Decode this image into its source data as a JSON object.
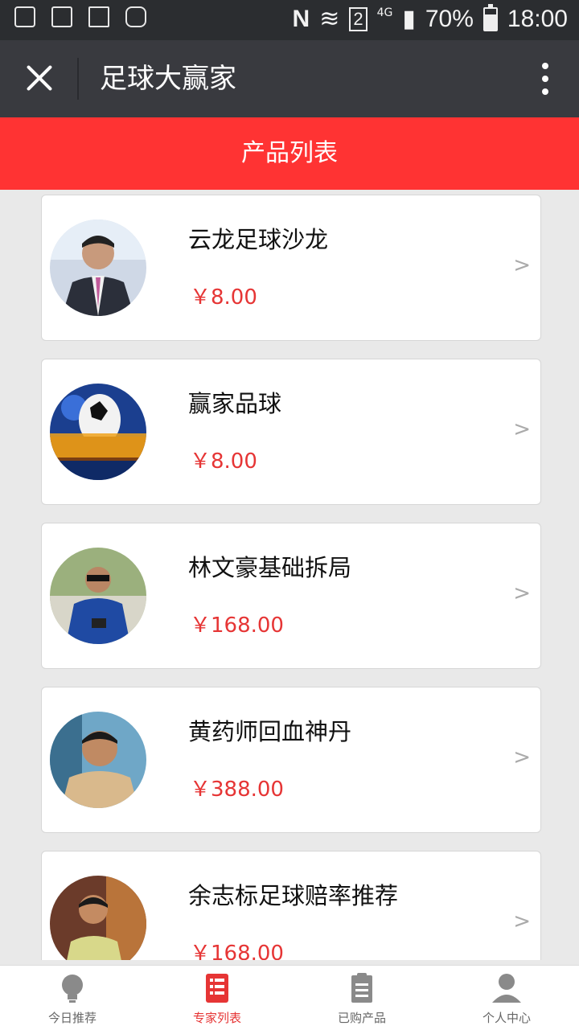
{
  "status_bar": {
    "signal_text": "4G",
    "sim_slot": "2",
    "battery_percent": "70%",
    "time": "18:00"
  },
  "titlebar": {
    "title": "足球大赢家"
  },
  "subheader": {
    "title": "产品列表"
  },
  "products": [
    {
      "name": "云龙足球沙龙",
      "price": "￥8.00"
    },
    {
      "name": "赢家品球",
      "price": "￥8.00"
    },
    {
      "name": "林文豪基础拆局",
      "price": "￥168.00"
    },
    {
      "name": "黄药师回血神丹",
      "price": "￥388.00"
    },
    {
      "name": "余志标足球赔率推荐",
      "price": "￥168.00"
    }
  ],
  "chevron": ">",
  "bottom_nav": {
    "items": [
      {
        "label": "今日推荐",
        "icon": "lightbulb-icon"
      },
      {
        "label": "专家列表",
        "icon": "list-icon"
      },
      {
        "label": "已购产品",
        "icon": "clipboard-icon"
      },
      {
        "label": "个人中心",
        "icon": "user-icon"
      }
    ],
    "active_index": 1
  },
  "colors": {
    "accent_red": "#ff3333",
    "price_red": "#e63535",
    "titlebar_bg": "#393a3f"
  }
}
